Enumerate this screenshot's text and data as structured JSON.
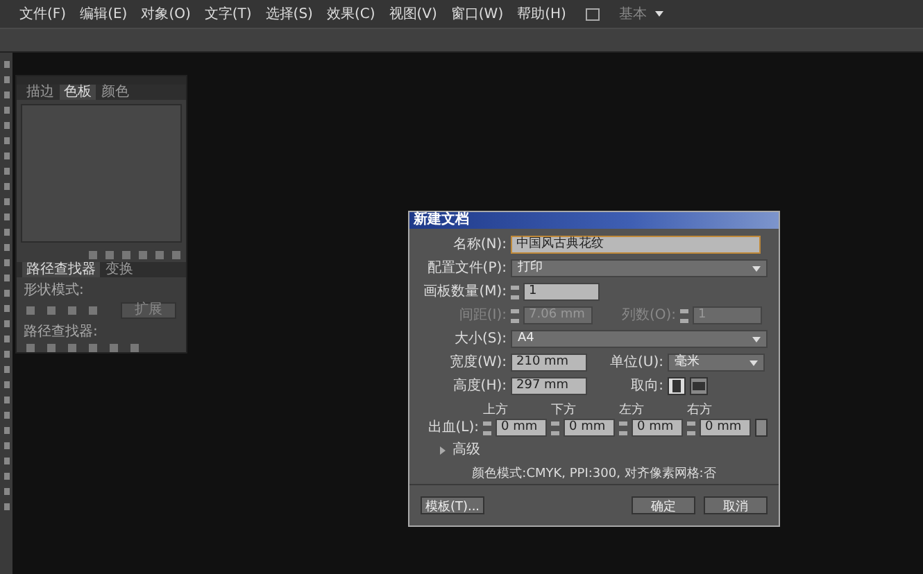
{
  "menu": [
    "文件(F)",
    "编辑(E)",
    "对象(O)",
    "文字(T)",
    "选择(S)",
    "效果(C)",
    "视图(V)",
    "窗口(W)",
    "帮助(H)"
  ],
  "workspace": "基本",
  "swatch_panel": {
    "tabs": [
      {
        "label": "描边",
        "selected": false
      },
      {
        "label": "色板",
        "selected": true
      },
      {
        "label": "颜色",
        "selected": false
      }
    ]
  },
  "pathfinder_panel": {
    "tabs": [
      {
        "label": "路径查找器",
        "selected": true
      },
      {
        "label": "变换",
        "selected": false
      }
    ],
    "shape_modes_label": "形状模式:",
    "expand_button": "扩展",
    "pathfinders_label": "路径查找器:"
  },
  "dialog": {
    "title": "新建文档",
    "name": {
      "label": "名称(N):",
      "value": "中国风古典花纹"
    },
    "profile": {
      "label": "配置文件(P):",
      "value": "打印"
    },
    "artboards": {
      "label": "画板数量(M):",
      "value": "1"
    },
    "spacing": {
      "label": "间距(I):",
      "value": "7.06 mm",
      "disabled": true
    },
    "columns": {
      "label": "列数(O):",
      "value": "1",
      "disabled": true
    },
    "size": {
      "label": "大小(S):",
      "value": "A4"
    },
    "width": {
      "label": "宽度(W):",
      "value": "210 mm"
    },
    "units": {
      "label": "单位(U):",
      "value": "毫米"
    },
    "height": {
      "label": "高度(H):",
      "value": "297 mm"
    },
    "orientation": {
      "label": "取向:",
      "options": [
        {
          "kind": "portrait",
          "selected": true
        },
        {
          "kind": "landscape",
          "selected": false
        }
      ]
    },
    "bleed": {
      "label": "出血(L):",
      "fields": [
        {
          "label": "上方",
          "value": "0 mm"
        },
        {
          "label": "下方",
          "value": "0 mm"
        },
        {
          "label": "左方",
          "value": "0 mm"
        },
        {
          "label": "右方",
          "value": "0 mm"
        }
      ]
    },
    "advanced": {
      "label": "高级",
      "expanded": false
    },
    "info": "颜色模式:CMYK, PPI:300, 对齐像素网格:否",
    "buttons": {
      "template": "模板(T)...",
      "ok": "确定",
      "cancel": "取消"
    }
  }
}
